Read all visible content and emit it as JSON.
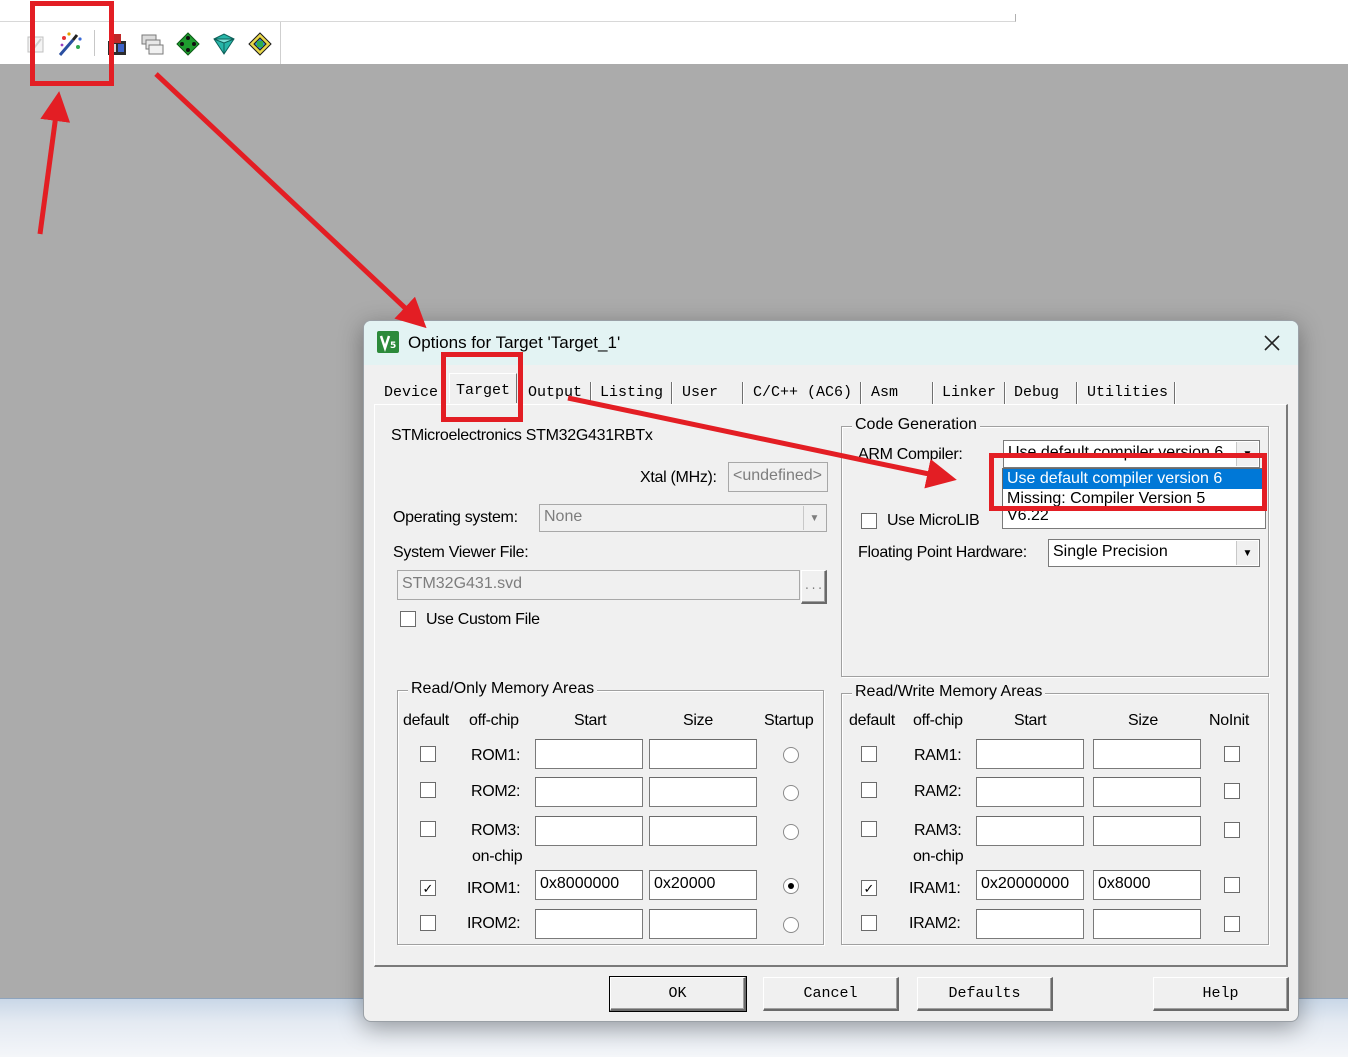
{
  "colors": {
    "annotation_red": "#e31e24",
    "selection_blue": "#0078d7"
  },
  "toolbar": {
    "icons": [
      "checkbox-icon",
      "magic-wand-icon",
      "file-extension-icon",
      "manage-multi-project-icon",
      "green-diamond-icon",
      "pack-installer-icon",
      "manage-runtime-icon"
    ]
  },
  "dialog": {
    "title": "Options for Target 'Target_1'",
    "tabs": [
      "Device",
      "Target",
      "Output",
      "Listing",
      "User",
      "C/C++ (AC6)",
      "Asm",
      "Linker",
      "Debug",
      "Utilities"
    ],
    "active_tab": "Target",
    "device_name": "STMicroelectronics STM32G431RBTx",
    "xtal": {
      "label": "Xtal (MHz):",
      "value": "<undefined>"
    },
    "os": {
      "label": "Operating system:",
      "value": "None"
    },
    "svd": {
      "label": "System Viewer File:",
      "value": "STM32G431.svd",
      "browse": "..."
    },
    "custom_file": {
      "label": "Use Custom File"
    },
    "code_gen": {
      "title": "Code Generation",
      "compiler_label": "ARM Compiler:",
      "compiler_value": "Use default compiler version 6",
      "compiler_options": [
        "Use default compiler version 6",
        "Missing: Compiler Version 5"
      ],
      "microlib_label": "Use MicroLIB",
      "version": "V6.22",
      "fph_label": "Floating Point Hardware:",
      "fph_value": "Single Precision"
    },
    "rom": {
      "title": "Read/Only Memory Areas",
      "headers": {
        "default": "default",
        "offchip": "off-chip",
        "start": "Start",
        "size": "Size",
        "startup": "Startup"
      },
      "onchip": "on-chip",
      "rows": [
        {
          "label": "ROM1:",
          "start": "",
          "size": ""
        },
        {
          "label": "ROM2:",
          "start": "",
          "size": ""
        },
        {
          "label": "ROM3:",
          "start": "",
          "size": ""
        },
        {
          "label": "IROM1:",
          "start": "0x8000000",
          "size": "0x20000"
        },
        {
          "label": "IROM2:",
          "start": "",
          "size": ""
        }
      ]
    },
    "ram": {
      "title": "Read/Write Memory Areas",
      "headers": {
        "default": "default",
        "offchip": "off-chip",
        "start": "Start",
        "size": "Size",
        "noinit": "NoInit"
      },
      "onchip": "on-chip",
      "rows": [
        {
          "label": "RAM1:",
          "start": "",
          "size": ""
        },
        {
          "label": "RAM2:",
          "start": "",
          "size": ""
        },
        {
          "label": "RAM3:",
          "start": "",
          "size": ""
        },
        {
          "label": "IRAM1:",
          "start": "0x20000000",
          "size": "0x8000"
        },
        {
          "label": "IRAM2:",
          "start": "",
          "size": ""
        }
      ]
    },
    "buttons": {
      "ok": "OK",
      "cancel": "Cancel",
      "defaults": "Defaults",
      "help": "Help"
    }
  }
}
